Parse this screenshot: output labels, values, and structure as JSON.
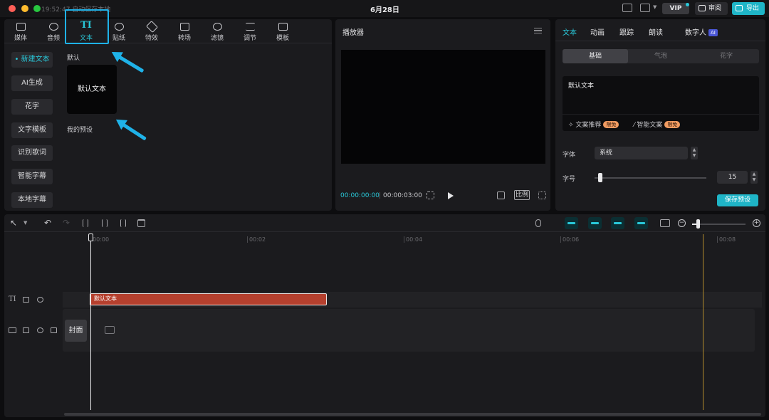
{
  "titlebar": {
    "autosave": "19:52:47 自动保存本地",
    "date_title": "6月28日",
    "vip": "VIP",
    "review": "审阅",
    "export": "导出"
  },
  "media": {
    "tabs": [
      {
        "label": "媒体",
        "icon": "media-icon"
      },
      {
        "label": "音频",
        "icon": "audio-icon"
      },
      {
        "label": "文本",
        "icon": "text-icon",
        "glyph": "TI"
      },
      {
        "label": "贴纸",
        "icon": "sticker-icon"
      },
      {
        "label": "特效",
        "icon": "effects-icon"
      },
      {
        "label": "转场",
        "icon": "transition-icon"
      },
      {
        "label": "滤镜",
        "icon": "filter-icon"
      },
      {
        "label": "调节",
        "icon": "adjust-icon"
      },
      {
        "label": "模板",
        "icon": "template-icon"
      }
    ],
    "sidebar": [
      "新建文本",
      "AI生成",
      "花字",
      "文字模板",
      "识别歌词",
      "智能字幕",
      "本地字幕"
    ],
    "section_default": "默认",
    "preset_card": "默认文本",
    "section_my_presets": "我的预设"
  },
  "player": {
    "title": "播放器",
    "time_current": "00:00:00:00",
    "time_separator": "|",
    "time_total": "00:00:03:00",
    "ratio": "比例"
  },
  "props": {
    "tabs": [
      "文本",
      "动画",
      "跟踪",
      "朗读",
      "数字人"
    ],
    "ai_badge": "AI",
    "subtabs": [
      "基础",
      "气泡",
      "花字"
    ],
    "text_value": "默认文本",
    "copy_suggest": "文案推荐",
    "smart_copy": "智能文案",
    "limited_free": "限免",
    "font_label": "字体",
    "font_value": "系统",
    "size_label": "字号",
    "size_value": "15",
    "size_slider_fraction": 0.04,
    "save_preset": "保存预设"
  },
  "timeline": {
    "ruler": [
      "00:00",
      "00:02",
      "00:04",
      "00:06",
      "00:08"
    ],
    "text_clip_label": "默认文本",
    "cover_label": "封面",
    "zoom_fraction": 0.13
  },
  "colors": {
    "accent": "#29c8d9",
    "annotation_blue": "#1fb2e8",
    "text_clip": "#b5402e"
  }
}
